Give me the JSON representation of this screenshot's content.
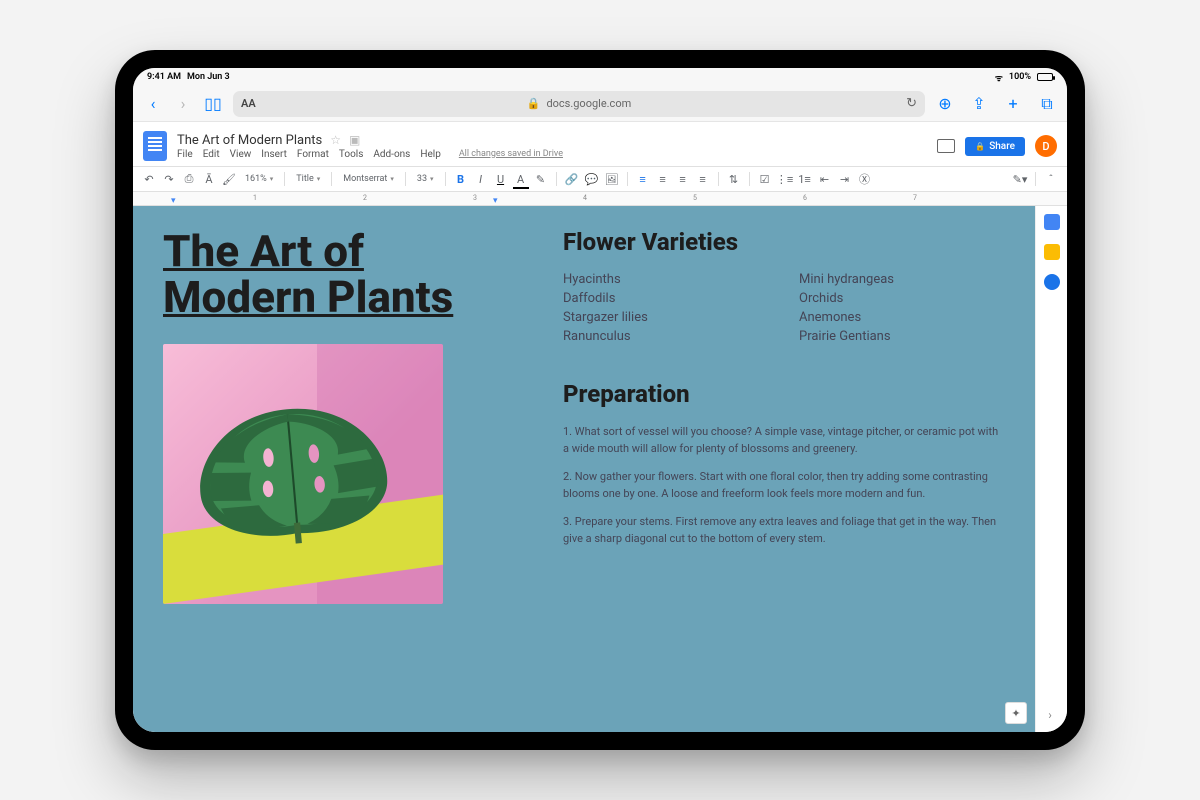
{
  "statusbar": {
    "time": "9:41 AM",
    "date": "Mon Jun 3",
    "battery": "100%"
  },
  "safari": {
    "url": "docs.google.com",
    "aa": "AA"
  },
  "docs": {
    "title": "The Art of Modern Plants",
    "menu": [
      "File",
      "Edit",
      "View",
      "Insert",
      "Format",
      "Tools",
      "Add-ons",
      "Help"
    ],
    "saved": "All changes saved in Drive",
    "share": "Share",
    "avatar": "D"
  },
  "toolbar": {
    "zoom": "161%",
    "style": "Title",
    "font": "Montserrat",
    "size": "33"
  },
  "ruler": {
    "marks": [
      "1",
      "2",
      "3",
      "4",
      "5",
      "6",
      "7"
    ]
  },
  "document": {
    "title": "The Art of Modern Plants",
    "section1_h": "Flower Varieties",
    "flowers_left": [
      "Hyacinths",
      "Daffodils",
      "Stargazer lilies",
      "Ranunculus"
    ],
    "flowers_right": [
      "Mini hydrangeas",
      "Orchids",
      "Anemones",
      "Prairie Gentians"
    ],
    "section2_h": "Preparation",
    "prep": [
      "1. What sort of vessel will you choose? A simple vase, vintage pitcher, or ceramic pot with a wide mouth will allow for plenty of blossoms and greenery.",
      "2. Now gather your flowers. Start with one floral color, then try adding some contrasting blooms one by one. A loose and freeform look feels more modern and fun.",
      "3. Prepare your stems. First remove any extra leaves and foliage that get in the way. Then give a sharp diagonal cut to the bottom of every stem."
    ]
  }
}
